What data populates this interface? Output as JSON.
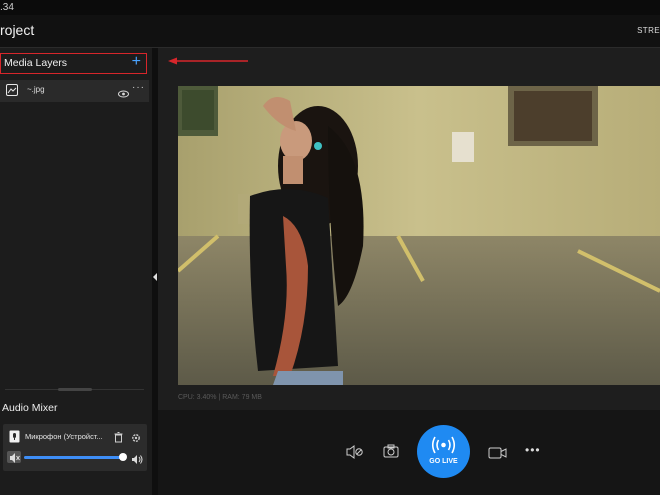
{
  "titlebar": {
    "version": ".34"
  },
  "appbar": {
    "project": "roject",
    "stream_label": "STRE"
  },
  "media_layers": {
    "title": "Media Layers",
    "add_glyph": "+",
    "items": [
      {
        "name": "~.jpg",
        "icon": "image-icon",
        "visible_icon": "eye-icon",
        "more_glyph": "···"
      }
    ]
  },
  "audio_mixer": {
    "title": "Audio Mixer",
    "source": {
      "name": "Микрофон (Устройст...",
      "volume_fraction": 0.98
    }
  },
  "stats": {
    "text": "CPU: 3.40% | RAM: 79 MB"
  },
  "controls": {
    "go_live_label": "GO LIVE",
    "more_glyph": "•••"
  },
  "colors": {
    "accent": "#1f8af2",
    "highlight_border": "#d7262b"
  }
}
